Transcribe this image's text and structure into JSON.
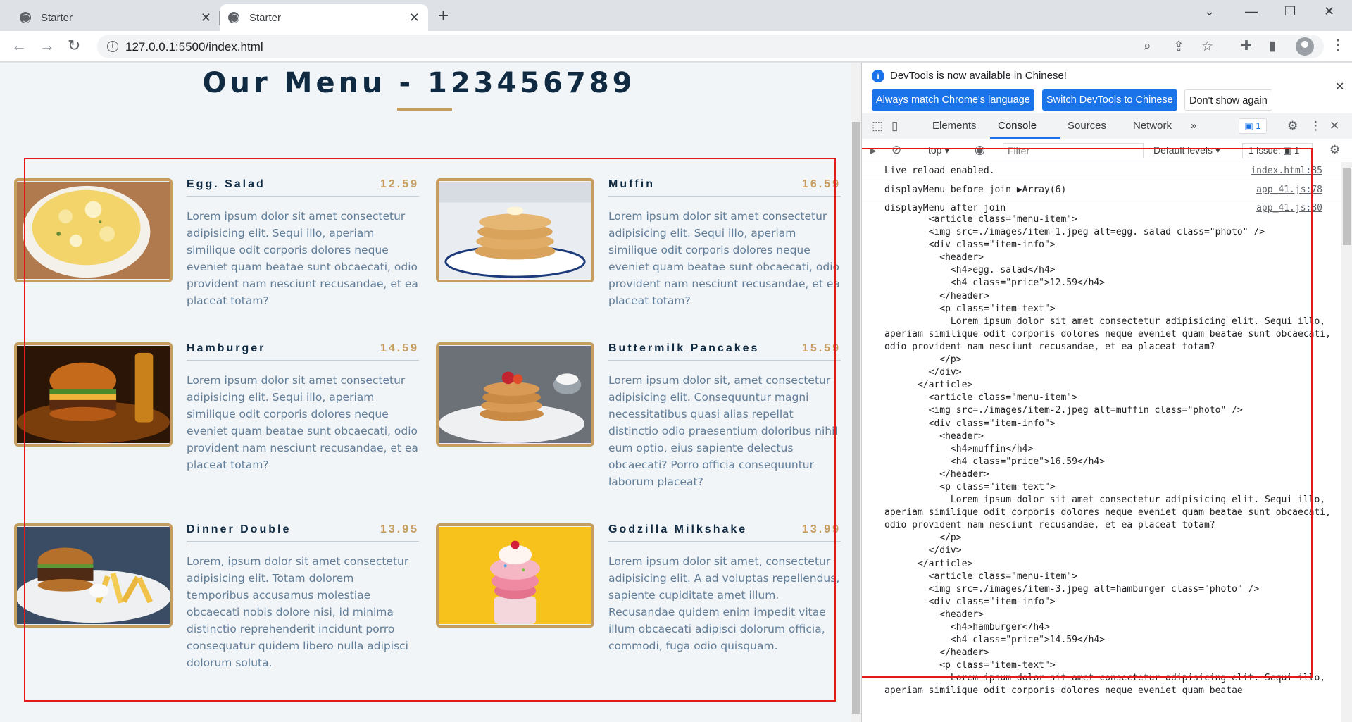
{
  "browser": {
    "tabs": [
      {
        "title": "Starter",
        "close": "✕"
      },
      {
        "title": "Starter",
        "close": "✕"
      }
    ],
    "new_tab": "+",
    "window_controls": {
      "minimize": "—",
      "maximize": "❐",
      "close": "✕",
      "tabsearch": "⌄"
    },
    "url": "127.0.0.1:5500/index.html"
  },
  "page": {
    "title": "Our Menu - 123456789",
    "items": [
      {
        "title": "Egg. Salad",
        "price": "12.59",
        "img": "egg-salad",
        "text": "Lorem ipsum dolor sit amet consectetur adipisicing elit. Sequi illo, aperiam similique odit corporis dolores neque eveniet quam beatae sunt obcaecati, odio provident nam nesciunt recusandae, et ea placeat totam?"
      },
      {
        "title": "Muffin",
        "price": "16.59",
        "img": "muffin",
        "text": "Lorem ipsum dolor sit amet consectetur adipisicing elit. Sequi illo, aperiam similique odit corporis dolores neque eveniet quam beatae sunt obcaecati, odio provident nam nesciunt recusandae, et ea placeat totam?"
      },
      {
        "title": "Hamburger",
        "price": "14.59",
        "img": "hamburger",
        "text": "Lorem ipsum dolor sit amet consectetur adipisicing elit. Sequi illo, aperiam similique odit corporis dolores neque eveniet quam beatae sunt obcaecati, odio provident nam nesciunt recusandae, et ea placeat totam?"
      },
      {
        "title": "Buttermilk Pancakes",
        "price": "15.59",
        "img": "pancakes",
        "text": "Lorem ipsum dolor sit, amet consectetur adipisicing elit. Consequuntur magni necessitatibus quasi alias repellat distinctio odio praesentium doloribus nihil eum optio, eius sapiente delectus obcaecati? Porro officia consequuntur laborum placeat?"
      },
      {
        "title": "Dinner Double",
        "price": "13.95",
        "img": "dinner",
        "text": "Lorem, ipsum dolor sit amet consectetur adipisicing elit. Totam dolorem temporibus accusamus molestiae obcaecati nobis dolore nisi, id minima distinctio reprehenderit incidunt porro consequatur quidem libero nulla adipisci dolorum soluta."
      },
      {
        "title": "Godzilla Milkshake",
        "price": "13.99",
        "img": "milkshake",
        "text": "Lorem ipsum dolor sit amet, consectetur adipisicing elit. A ad voluptas repellendus, sapiente cupiditate amet illum. Recusandae quidem enim impedit vitae illum obcaecati adipisci dolorum officia, commodi, fuga odio quisquam."
      }
    ]
  },
  "devtools": {
    "info_text": "DevTools is now available in Chinese!",
    "btn_match": "Always match Chrome's language",
    "btn_switch": "Switch DevTools to Chinese",
    "btn_dont": "Don't show again",
    "tabs": [
      "Elements",
      "Console",
      "Sources",
      "Network"
    ],
    "more_tabs": "»",
    "messages_badge": "1",
    "context": "top ▾",
    "filter_placeholder": "Filter",
    "levels": "Default levels ▾",
    "issues": "1 Issue: ▣ 1",
    "console": [
      {
        "msg": "Live reload enabled.",
        "src": "index.html:85"
      },
      {
        "msg": "displayMenu before join ▶Array(6)",
        "src": "app_41.js:78"
      },
      {
        "msg": "displayMenu after join",
        "src": "app_41.js:80"
      }
    ],
    "join_output": "        <article class=\"menu-item\">\n        <img src=./images/item-1.jpeg alt=egg. salad class=\"photo\" />\n        <div class=\"item-info\">\n          <header>\n            <h4>egg. salad</h4>\n            <h4 class=\"price\">12.59</h4>\n          </header>\n          <p class=\"item-text\">\n            Lorem ipsum dolor sit amet consectetur adipisicing elit. Sequi illo, aperiam similique odit corporis dolores neque eveniet quam beatae sunt obcaecati, odio provident nam nesciunt recusandae, et ea placeat totam?\n          </p>\n        </div>\n      </article>\n        <article class=\"menu-item\">\n        <img src=./images/item-2.jpeg alt=muffin class=\"photo\" />\n        <div class=\"item-info\">\n          <header>\n            <h4>muffin</h4>\n            <h4 class=\"price\">16.59</h4>\n          </header>\n          <p class=\"item-text\">\n            Lorem ipsum dolor sit amet consectetur adipisicing elit. Sequi illo, aperiam similique odit corporis dolores neque eveniet quam beatae sunt obcaecati, odio provident nam nesciunt recusandae, et ea placeat totam?\n          </p>\n        </div>\n      </article>\n        <article class=\"menu-item\">\n        <img src=./images/item-3.jpeg alt=hamburger class=\"photo\" />\n        <div class=\"item-info\">\n          <header>\n            <h4>hamburger</h4>\n            <h4 class=\"price\">14.59</h4>\n          </header>\n          <p class=\"item-text\">\n            Lorem ipsum dolor sit amet consectetur adipisicing elit. Sequi illo, aperiam similique odit corporis dolores neque eveniet quam beatae"
  },
  "colors": {
    "accent": "#c59d5f",
    "title": "#102a42",
    "body_text": "#617d98",
    "annotation": "#e21a1a",
    "devtools_blue": "#1a73e8"
  }
}
